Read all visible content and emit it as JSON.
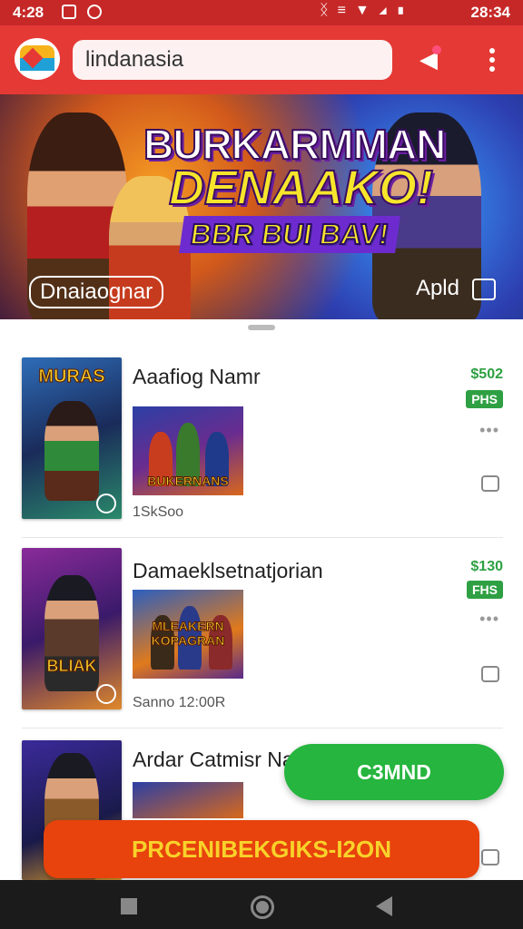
{
  "status_bar": {
    "time_left": "4:28",
    "time_right": "28:34",
    "icons": [
      "bluetooth-icon",
      "vibrate-icon",
      "wifi-icon",
      "signal-icon",
      "battery-icon"
    ]
  },
  "app_bar": {
    "search_value": "lindanasia"
  },
  "banner": {
    "title_line1": "BURKARMMAN",
    "title_line2": "DENAAKO!",
    "title_line3": "BBR BUI BAV!",
    "left_label": "Dnaiaognar",
    "right_label": "Apld"
  },
  "cards": [
    {
      "poster_title": "MURAS",
      "name": "Aaafiog Namr",
      "thumb_text": "BUKERNANS",
      "meta": "1SkSoo",
      "price": "$502",
      "badge": "PHS"
    },
    {
      "poster_title": "BLIAK",
      "name": "Damaeklsetnatjorian",
      "thumb_text": "MLEAKERN KOPAGRAN",
      "meta": "Sanno 12:00R",
      "price": "$130",
      "badge": "FHS"
    },
    {
      "poster_title": "",
      "name": "Ardar Catmisr Nan",
      "thumb_text": "",
      "meta": "",
      "price": "",
      "badge": ""
    }
  ],
  "fab": {
    "label": "C3MND"
  },
  "cta": {
    "label": "PRCENIBEKGIKS-I2ON"
  },
  "colors": {
    "header_red": "#e53935",
    "status_red": "#c62828",
    "accent_green": "#2ea043",
    "fab_green": "#26b53e",
    "cta_orange": "#e8420d",
    "cta_text": "#f8d22a"
  }
}
